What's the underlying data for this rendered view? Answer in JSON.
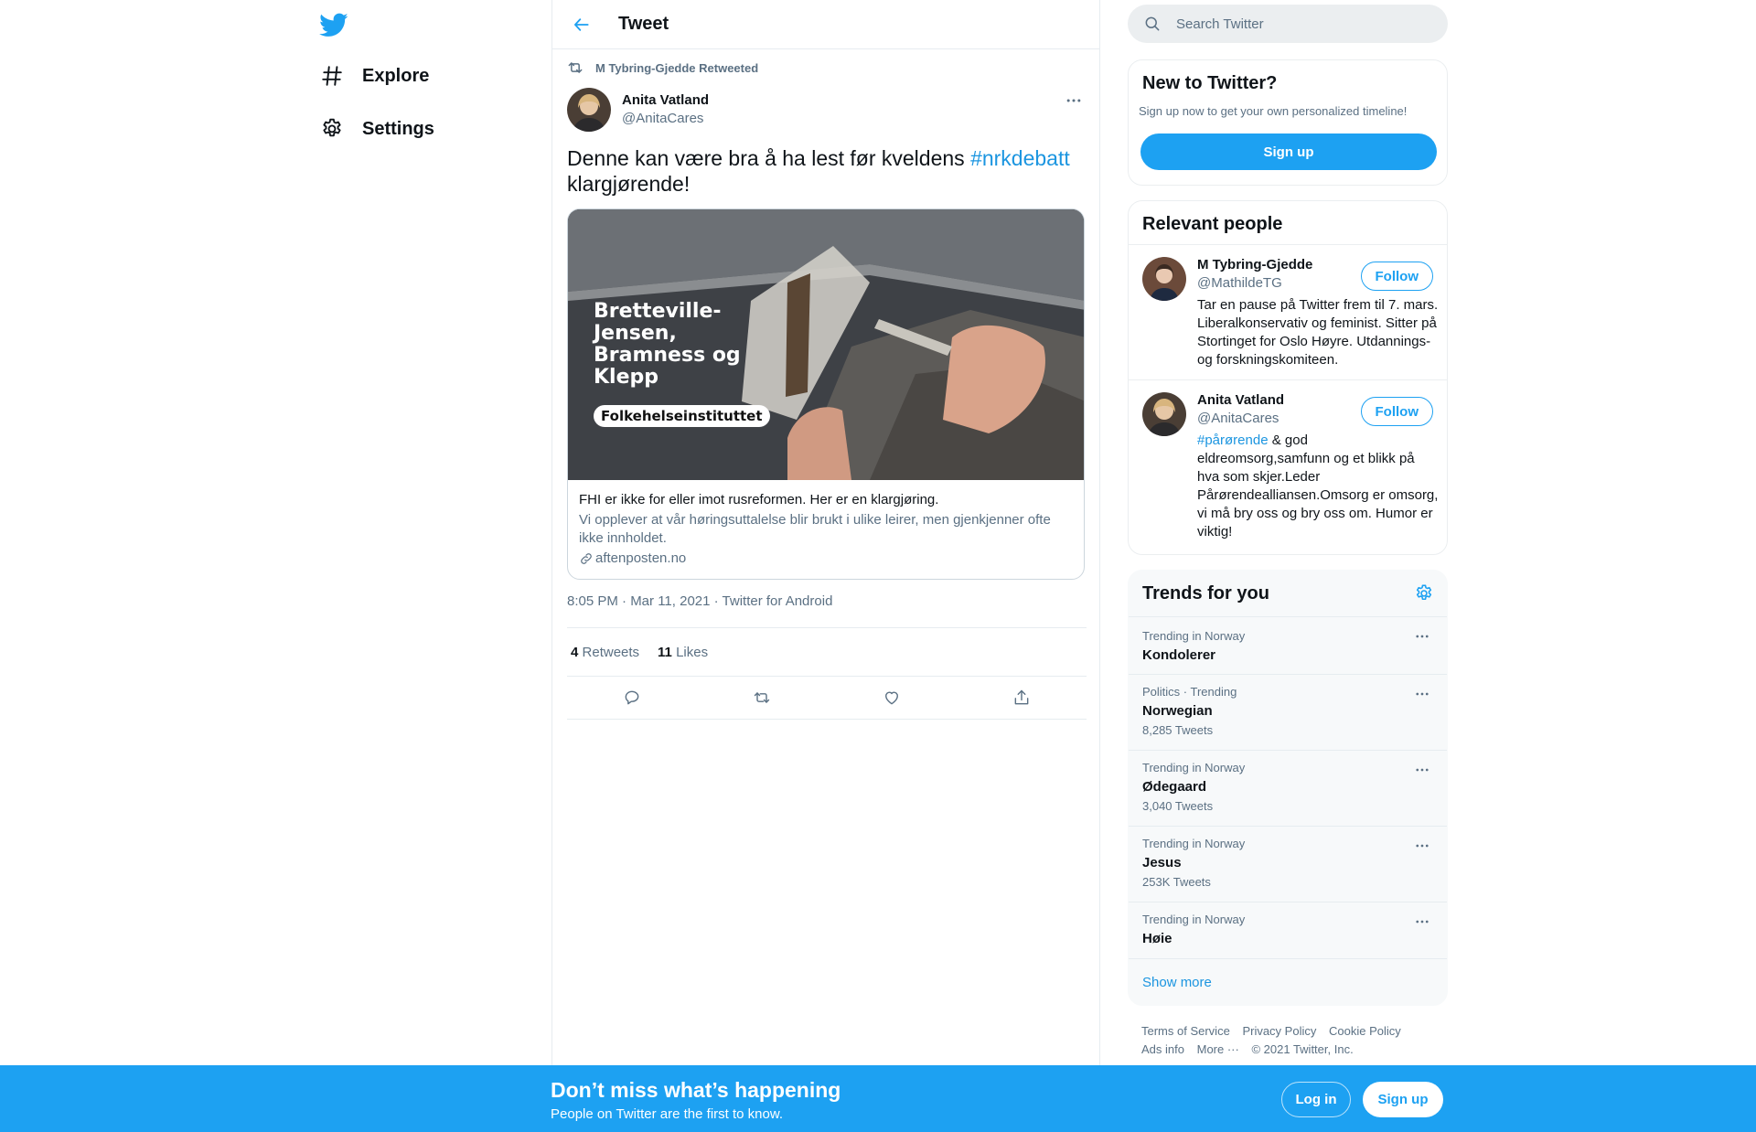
{
  "nav": {
    "logo_icon": "twitter-bird-icon",
    "items": [
      {
        "label": "Explore",
        "icon": "hashtag-icon"
      },
      {
        "label": "Settings",
        "icon": "gear-icon"
      }
    ]
  },
  "header": {
    "back_icon": "arrow-left-icon",
    "title": "Tweet"
  },
  "tweet": {
    "retweeted_by": "M Tybring-Gjedde Retweeted",
    "author_name": "Anita Vatland",
    "author_handle": "@AnitaCares",
    "text_before": "Denne kan være bra å ha lest før kveldens ",
    "hashtag": "#nrkdebatt",
    "text_after": " klargjørende!",
    "card": {
      "image_lines": [
        "Bretteville-",
        "Jensen,",
        "Bramness og",
        "Klepp"
      ],
      "image_badge": "Folkehelseinstituttet",
      "title": "FHI er ikke for eller imot rusreformen. Her er en klargjøring.",
      "description": "Vi opplever at vår høringsuttalelse blir brukt i ulike leirer, men gjenkjenner ofte ikke innholdet.",
      "domain": "aftenposten.no"
    },
    "meta": "8:05 PM · Mar 11, 2021 · Twitter for Android",
    "retweets_count": "4",
    "retweets_label": "Retweets",
    "likes_count": "11",
    "likes_label": "Likes"
  },
  "search": {
    "placeholder": "Search Twitter"
  },
  "new_to_twitter": {
    "title": "New to Twitter?",
    "subtitle": "Sign up now to get your own personalized timeline!",
    "signup_label": "Sign up"
  },
  "relevant_people": {
    "title": "Relevant people",
    "people": [
      {
        "name": "M Tybring-Gjedde",
        "handle": "@MathildeTG",
        "follow_label": "Follow",
        "bio": "Tar en pause på Twitter frem til 7. mars. Liberalkonservativ og feminist. Sitter på Stortinget for Oslo Høyre. Utdannings- og forskningskomiteen."
      },
      {
        "name": "Anita Vatland",
        "handle": "@AnitaCares",
        "follow_label": "Follow",
        "bio_hashtag": "#pårørende",
        "bio": " & god eldreomsorg,samfunn og et blikk på hva som skjer.Leder Pårørendealliansen.Omsorg er omsorg, vi må bry oss og bry oss om. Humor er viktig!"
      }
    ]
  },
  "trends": {
    "title": "Trends for you",
    "items": [
      {
        "context": "Trending in Norway",
        "name": "Kondolerer",
        "count": ""
      },
      {
        "context": "Politics · Trending",
        "name": "Norwegian",
        "count": "8,285 Tweets"
      },
      {
        "context": "Trending in Norway",
        "name": "Ødegaard",
        "count": "3,040 Tweets"
      },
      {
        "context": "Trending in Norway",
        "name": "Jesus",
        "count": "253K Tweets"
      },
      {
        "context": "Trending in Norway",
        "name": "Høie",
        "count": ""
      }
    ],
    "show_more": "Show more"
  },
  "footer": {
    "links": [
      "Terms of Service",
      "Privacy Policy",
      "Cookie Policy",
      "Ads info",
      "More ···"
    ],
    "copyright": "© 2021 Twitter, Inc."
  },
  "bottom_bar": {
    "title": "Don’t miss what’s happening",
    "subtitle": "People on Twitter are the first to know.",
    "login_label": "Log in",
    "signup_label": "Sign up"
  },
  "colors": {
    "accent": "#1da1f2",
    "link": "#1b95e0",
    "muted": "#5b7083"
  }
}
